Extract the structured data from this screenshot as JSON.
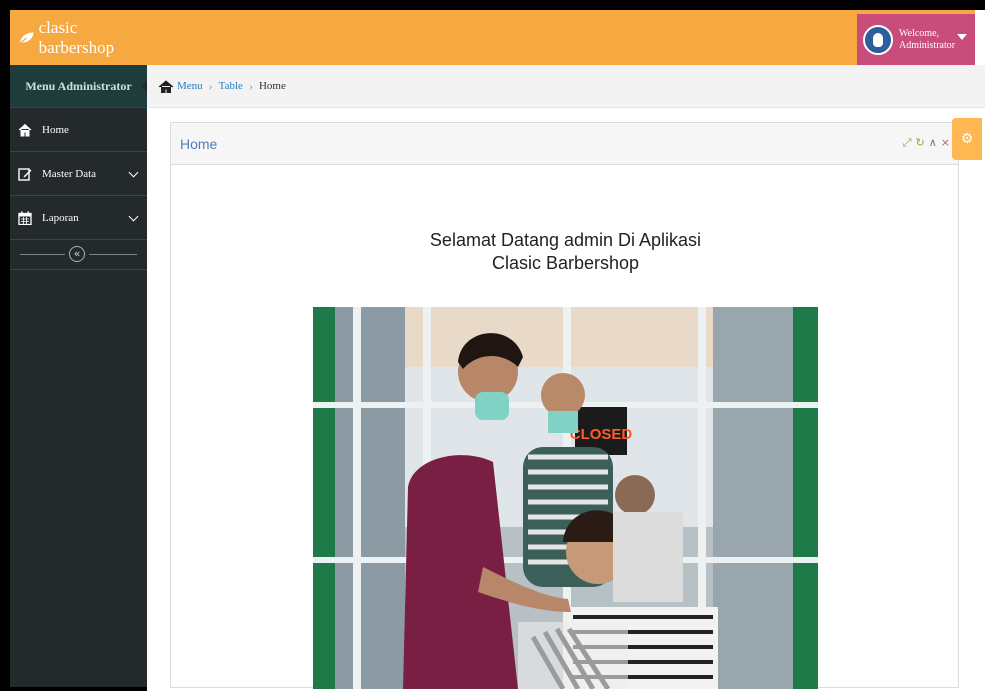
{
  "navbar": {
    "brand": "clasic barbershop",
    "welcome_line1": "Welcome,",
    "welcome_line2": "Administrator"
  },
  "sidebar": {
    "title": "Menu Administrator",
    "items": [
      {
        "label": "Home",
        "icon": "home-icon"
      },
      {
        "label": "Master Data",
        "icon": "edit-icon"
      },
      {
        "label": "Laporan",
        "icon": "calendar-icon"
      }
    ],
    "collapse_glyph": "«"
  },
  "breadcrumb": {
    "items": [
      "Menu",
      "Table",
      "Home"
    ]
  },
  "widget": {
    "title": "Home",
    "welcome_line1": "Selamat Datang admin Di Aplikasi",
    "welcome_line2": "Clasic Barbershop",
    "photo_sign": "CLOSED"
  },
  "colors": {
    "navbar": "#f5a940",
    "user_box": "#c94d7a",
    "sidebar": "#242a2b",
    "accent_blue": "#4f7eb3"
  }
}
